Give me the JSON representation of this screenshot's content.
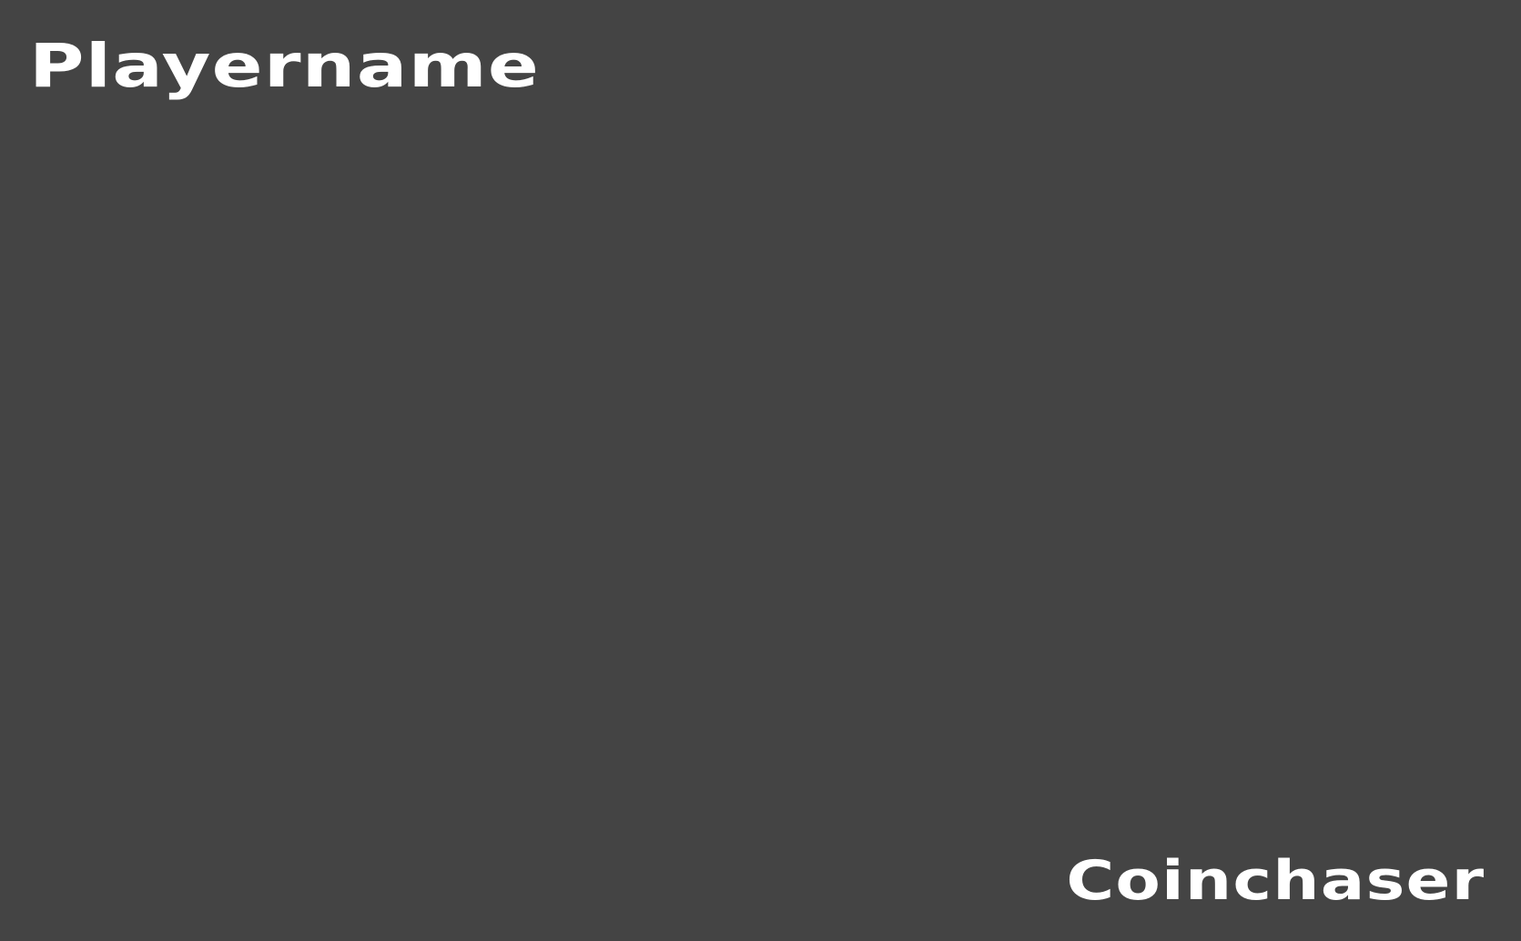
{
  "hud": {
    "player_name": "Playername",
    "game_title": "Coinchaser"
  },
  "colors": {
    "background": "#444444",
    "text": "#ffffff"
  }
}
